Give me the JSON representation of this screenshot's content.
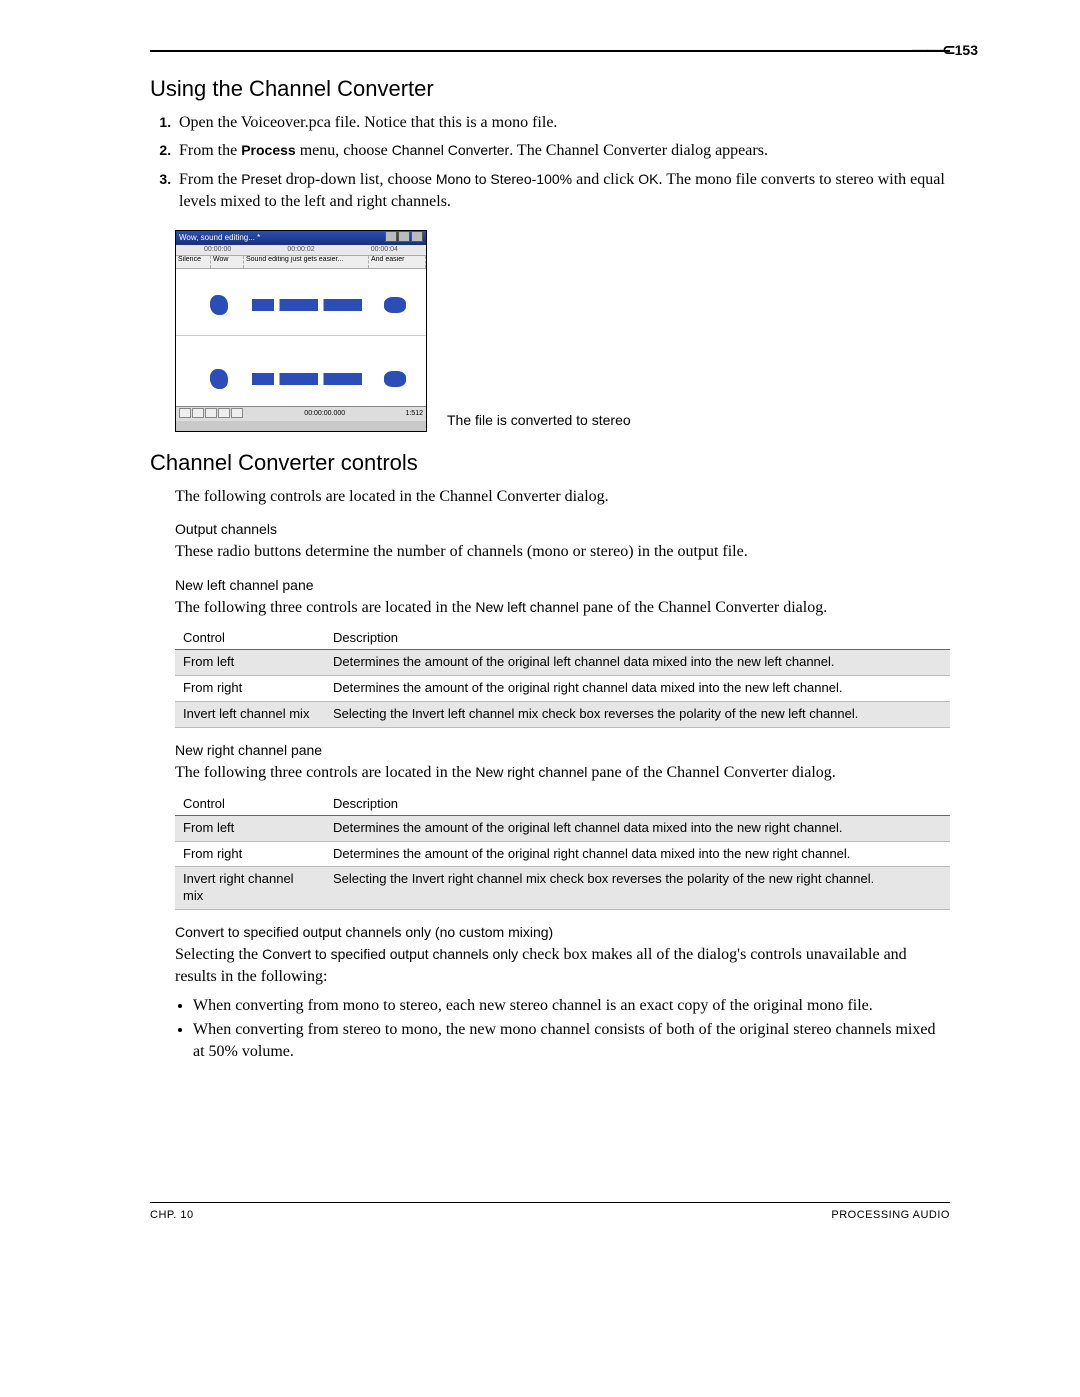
{
  "page_number": "153",
  "h1": "Using the Channel Converter",
  "steps": {
    "s1": {
      "text": "Open the Voiceover.pca file. Notice that this is a mono file."
    },
    "s2": {
      "lead": "From the ",
      "menu": "Process",
      "mid": " menu, choose ",
      "cmd": "Channel Converter",
      "tail": ". The Channel Converter dialog appears."
    },
    "s3": {
      "lead": "From the ",
      "dropdown": "Preset",
      "mid": " drop-down list, choose ",
      "preset": "Mono to Stereo-100%",
      "mid2": " and click ",
      "ok": "OK",
      "tail": ". The mono file converts to stereo with equal levels mixed to the left and right channels."
    }
  },
  "screenshot": {
    "title": "Wow, sound editing... *",
    "time_left": "00:00:00",
    "time_mid": "00:00:02",
    "time_right": "00:00:04",
    "markers": [
      "Silence",
      "Wow",
      "Sound editing just gets easier...",
      "And easier"
    ],
    "counter": "00:00:00.000",
    "rate": "1:512"
  },
  "fig_caption": "The file is converted to stereo",
  "h1b": "Channel Converter controls",
  "intro2": "The following controls are located in the Channel Converter dialog.",
  "output_h": "Output channels",
  "output_p": "These radio buttons determine the number of channels (mono or stereo) in the output file.",
  "newleft_h": "New left channel pane",
  "newleft_p_lead": "The following three controls are located in the ",
  "newleft_p_ui": "New left channel",
  "newleft_p_tail": " pane of the Channel Converter dialog.",
  "table_headers": {
    "c1": "Control",
    "c2": "Description"
  },
  "table_left": [
    {
      "c": "From left",
      "d": "Determines the amount of the original left channel data mixed into the new left channel."
    },
    {
      "c": "From right",
      "d": "Determines the amount of the original right channel data mixed into the new left channel."
    },
    {
      "c": "Invert left channel mix",
      "d": "Selecting the Invert left channel mix check box reverses the polarity of the new left channel."
    }
  ],
  "newright_h": "New right channel pane",
  "newright_p_lead": "The following three controls are located in the ",
  "newright_p_ui": "New right channel",
  "newright_p_tail": " pane of the Channel Converter dialog.",
  "table_right": [
    {
      "c": "From left",
      "d": "Determines the amount of the original left channel data mixed into the new right channel."
    },
    {
      "c": "From right",
      "d": "Determines the amount of the original right channel data mixed into the new right channel."
    },
    {
      "c": "Invert right channel mix",
      "d": "Selecting the Invert right channel mix check box reverses the polarity of the new right channel."
    }
  ],
  "convert_h": "Convert to specified output channels only (no custom mixing)",
  "convert_p_lead": "Selecting the ",
  "convert_p_ui": "Convert to specified output channels only",
  "convert_p_tail": " check box makes all of the dialog's controls unavailable and results in the following:",
  "bullets": [
    "When converting from mono to stereo, each new stereo channel is an exact copy of the original mono file.",
    "When converting from stereo to mono, the new mono channel consists of both of the original stereo channels mixed at 50% volume."
  ],
  "footer": {
    "left": "CHP. 10",
    "right": "PROCESSING AUDIO"
  }
}
